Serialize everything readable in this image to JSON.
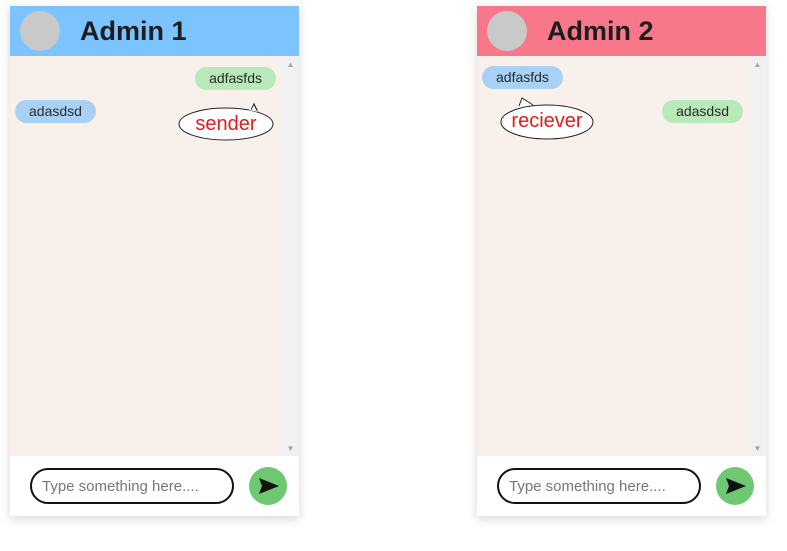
{
  "chats": [
    {
      "title": "Admin 1",
      "messages": [
        {
          "text": "adfasfds",
          "type": "sent"
        },
        {
          "text": "adasdsd",
          "type": "received"
        }
      ],
      "note": "sender",
      "input": {
        "placeholder": "Type something here...."
      },
      "header_color": "#7cc4ff"
    },
    {
      "title": "Admin 2",
      "messages": [
        {
          "text": "adfasfds",
          "type": "received"
        },
        {
          "text": "adasdsd",
          "type": "sent"
        }
      ],
      "note": "reciever",
      "input": {
        "placeholder": "Type something here...."
      },
      "header_color": "#f7788b"
    }
  ],
  "colors": {
    "sent_bubble": "#b7e9b9",
    "received_bubble": "#a9d1f6",
    "chat_background": "#f8f0ea",
    "send_button": "#6ec872",
    "annotation_text": "#e21b1b"
  },
  "icons": {
    "send": "send-arrow-icon",
    "avatar": "avatar-placeholder"
  }
}
